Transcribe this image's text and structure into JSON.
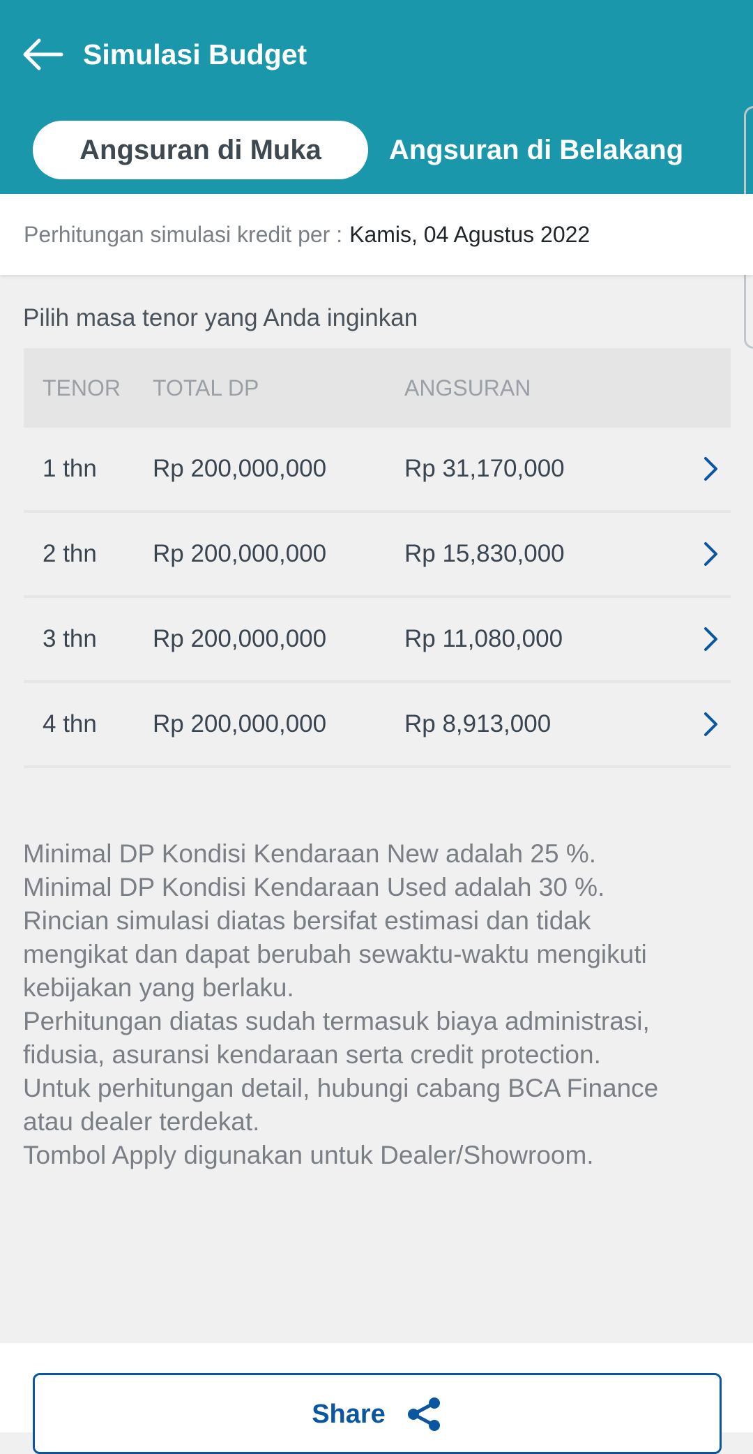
{
  "header": {
    "title": "Simulasi Budget",
    "back_icon": "arrow-left-icon",
    "color": "#1a97ab"
  },
  "tabs": [
    {
      "label": "Angsuran di Muka",
      "active": true
    },
    {
      "label": "Angsuran di Belakang",
      "active": false
    }
  ],
  "date_bar": {
    "label": "Perhitungan simulasi kredit per :",
    "value": "Kamis, 04 Agustus 2022"
  },
  "tenor_section": {
    "label": "Pilih masa tenor yang Anda inginkan",
    "columns": [
      "TENOR",
      "TOTAL DP",
      "ANGSURAN"
    ],
    "rows": [
      {
        "tenor": "1 thn",
        "total_dp": "Rp 200,000,000",
        "angsuran": "Rp 31,170,000"
      },
      {
        "tenor": "2 thn",
        "total_dp": "Rp 200,000,000",
        "angsuran": "Rp 15,830,000"
      },
      {
        "tenor": "3 thn",
        "total_dp": "Rp 200,000,000",
        "angsuran": "Rp 11,080,000"
      },
      {
        "tenor": "4 thn",
        "total_dp": "Rp 200,000,000",
        "angsuran": "Rp 8,913,000"
      }
    ],
    "row_icon": "chevron-right-icon"
  },
  "notes": [
    "Minimal DP Kondisi Kendaraan New adalah 25 %.",
    "Minimal DP Kondisi Kendaraan Used adalah 30 %.",
    "Rincian simulasi diatas bersifat estimasi dan tidak",
    "mengikat dan dapat berubah sewaktu-waktu mengikuti",
    "kebijakan yang berlaku.",
    "Perhitungan diatas sudah termasuk biaya administrasi,",
    "fidusia, asuransi kendaraan serta credit protection.",
    "Untuk perhitungan detail, hubungi cabang BCA Finance",
    "atau dealer terdekat.",
    "Tombol Apply digunakan untuk Dealer/Showroom."
  ],
  "share": {
    "label": "Share",
    "icon": "share-icon",
    "color": "#0a56a0"
  }
}
